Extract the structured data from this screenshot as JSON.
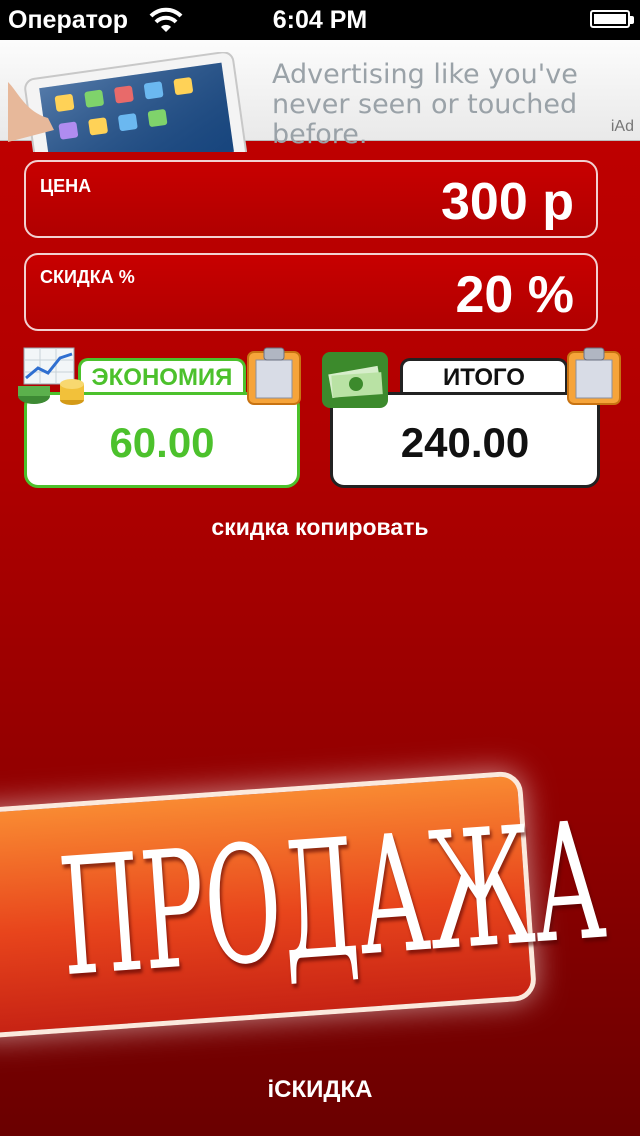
{
  "status_bar": {
    "carrier": "Оператор",
    "time": "6:04 PM"
  },
  "ad": {
    "text": "Advertising like you've never seen or touched before.",
    "label": "iAd"
  },
  "price": {
    "label": "ЦЕНА",
    "value": "300 р"
  },
  "discount": {
    "label": "СКИДКА %",
    "value": "20 %"
  },
  "savings": {
    "label": "ЭКОНОМИЯ",
    "value": "60.00",
    "color": "#4cc12c"
  },
  "total": {
    "label": "ИТОГО",
    "value": "240.00"
  },
  "copy_link": "скидка копировать",
  "sale_banner": "ПРОДАЖА",
  "app_name": "iСКИДКА",
  "icons": {
    "savings": "chart-coins-icon",
    "total": "money-stack-icon",
    "clipboard": "clipboard-icon"
  }
}
